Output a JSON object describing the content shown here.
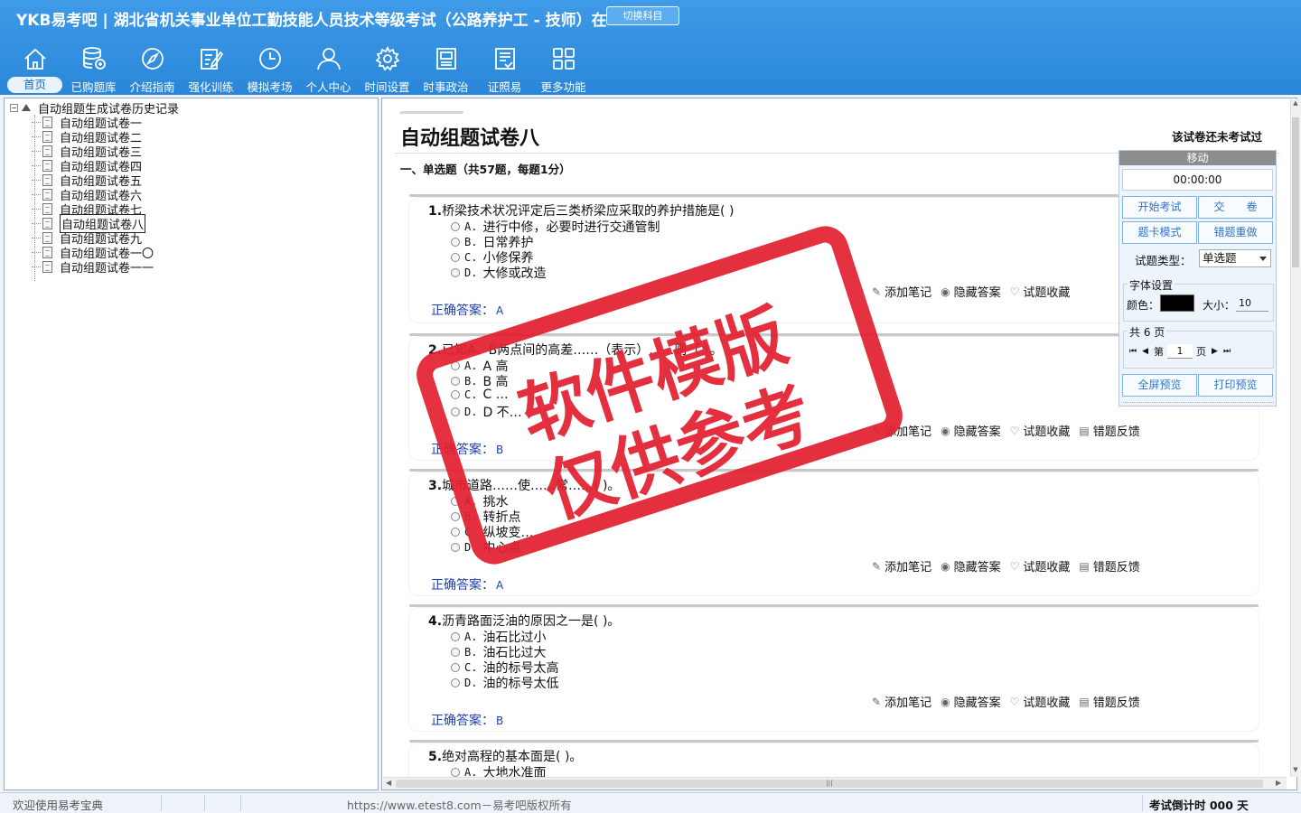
{
  "header": {
    "brand": "YKB易考吧",
    "exam_title": "湖北省机关事业单位工勤技能人员技术等级考试（公路养护工 - 技师）在",
    "switch_label": "切换科目"
  },
  "nav": [
    {
      "label": "首页",
      "icon": "home-icon"
    },
    {
      "label": "已购题库",
      "icon": "database-icon"
    },
    {
      "label": "介绍指南",
      "icon": "compass-icon"
    },
    {
      "label": "强化训练",
      "icon": "edit-icon"
    },
    {
      "label": "模拟考场",
      "icon": "clock-icon"
    },
    {
      "label": "个人中心",
      "icon": "user-icon"
    },
    {
      "label": "时间设置",
      "icon": "gear-icon"
    },
    {
      "label": "时事政治",
      "icon": "news-icon"
    },
    {
      "label": "证照易",
      "icon": "certificate-icon"
    },
    {
      "label": "更多功能",
      "icon": "grid-icon"
    }
  ],
  "tree": {
    "root": "自动组题生成试卷历史记录",
    "items": [
      "自动组题试卷一",
      "自动组题试卷二",
      "自动组题试卷三",
      "自动组题试卷四",
      "自动组题试卷五",
      "自动组题试卷六",
      "自动组题试卷七",
      "自动组题试卷八",
      "自动组题试卷九",
      "自动组题试卷一〇",
      "自动组题试卷一一"
    ]
  },
  "paper": {
    "title": "自动组题试卷八",
    "status": "该试卷还未考试过",
    "section": "一、单选题（共57题，每题1分）",
    "answer_label": "正确答案：",
    "actions": [
      "添加笔记",
      "隐藏答案",
      "试题收藏",
      "错题反馈"
    ],
    "questions": [
      {
        "num": "1.",
        "stem": "桥梁技术状况评定后三类桥梁应采取的养护措施是( )",
        "options": [
          "A.|进行中修，必要时进行交通管制",
          "B.|日常养护",
          "C.|小修保养",
          "D.|大修或改造"
        ],
        "answer": "A"
      },
      {
        "num": "2.",
        "stem": "已知A、B两点间的高差……（表示）……则（ ）。",
        "options": [
          "A.|A 高",
          "B.|B 高",
          "C.|C …",
          "D.|D 不…"
        ],
        "answer": "B"
      },
      {
        "num": "3.",
        "stem": "城市道路……使……常……( )。",
        "options": [
          "A.|挑水",
          "B.|转折点",
          "C.|纵坡变…",
          "D.|中心点"
        ],
        "answer": "A"
      },
      {
        "num": "4.",
        "stem": "沥青路面泛油的原因之一是( )。",
        "options": [
          "A.|油石比过小",
          "B.|油石比过大",
          "C.|油的标号太高",
          "D.|油的标号太低"
        ],
        "answer": "B"
      },
      {
        "num": "5.",
        "stem": "绝对高程的基本面是( )。",
        "options": [
          "A.|大地水准面"
        ],
        "answer": ""
      }
    ]
  },
  "panel": {
    "move": "移动",
    "timer": "00:00:00",
    "start": "开始考试",
    "submit": "交　　卷",
    "card_mode": "题卡模式",
    "redo_wrong": "错题重做",
    "type_label": "试题类型：",
    "type_value": "单选题",
    "font_legend": "字体设置",
    "color_label": "颜色：",
    "size_label": "大小：",
    "size_value": "10",
    "pages_legend": "共 6 页",
    "page_prefix": "第",
    "page_value": "1",
    "page_suffix": "页",
    "fullscreen": "全屏预览",
    "print": "打印预览"
  },
  "status": {
    "left": "欢迎使用易考宝典",
    "mid": "https://www.etest8.com－易考吧版权所有",
    "right": "考试倒计时 000 天"
  },
  "watermark": {
    "line1": "软件模版",
    "line2": "仅供参考"
  },
  "colors": {
    "header_blue": "#2a86d8",
    "answer_blue": "#1f3fb0",
    "stamp_red": "#e22030"
  }
}
